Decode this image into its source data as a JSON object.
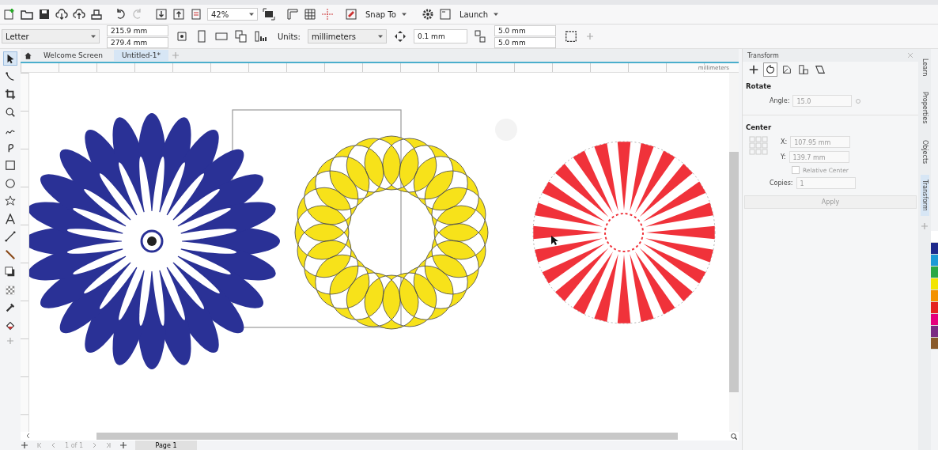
{
  "toolbar": {
    "zoom": "42%",
    "snap": "Snap To",
    "launch": "Launch"
  },
  "property_bar": {
    "paper": "Letter",
    "width": "215.9 mm",
    "height": "279.4 mm",
    "units_label": "Units:",
    "units": "millimeters",
    "nudge": "0.1 mm",
    "dup_h": "5.0 mm",
    "dup_v": "5.0 mm"
  },
  "tabs": [
    {
      "label": "Welcome Screen",
      "selected": false
    },
    {
      "label": "Untitled-1*",
      "selected": true
    }
  ],
  "ruler_unit": "millimeters",
  "tools": [
    {
      "kind": "pick",
      "selected": true
    },
    {
      "kind": "shape",
      "selected": false
    },
    {
      "kind": "crop",
      "selected": false
    },
    {
      "kind": "zoom",
      "selected": false
    },
    {
      "kind": "freehand",
      "selected": false
    },
    {
      "kind": "artistic",
      "selected": false
    },
    {
      "kind": "rect",
      "selected": false
    },
    {
      "kind": "ellipse",
      "selected": false
    },
    {
      "kind": "star",
      "selected": false
    },
    {
      "kind": "text",
      "selected": false
    },
    {
      "kind": "dimension",
      "selected": false
    },
    {
      "kind": "connector",
      "selected": false
    },
    {
      "kind": "shadow",
      "selected": false
    },
    {
      "kind": "transparency",
      "selected": false
    },
    {
      "kind": "eyedropper",
      "selected": false
    },
    {
      "kind": "fill",
      "selected": false
    }
  ],
  "docker": {
    "title": "Transform",
    "modes": [
      {
        "kind": "position",
        "selected": false
      },
      {
        "kind": "rotate",
        "selected": true
      },
      {
        "kind": "scale",
        "selected": false
      },
      {
        "kind": "size",
        "selected": false
      },
      {
        "kind": "skew",
        "selected": false
      }
    ],
    "rotate_heading": "Rotate",
    "angle_label": "Angle:",
    "angle": "15.0",
    "center_heading": "Center",
    "x_label": "X:",
    "x": "107.95 mm",
    "y_label": "Y:",
    "y": "139.7 mm",
    "relative_center": {
      "label": "Relative Center",
      "checked": false
    },
    "copies_label": "Copies:",
    "copies": "1",
    "apply": "Apply"
  },
  "side_tabs": [
    {
      "label": "Learn",
      "selected": false
    },
    {
      "label": "Properties",
      "selected": false
    },
    {
      "label": "Objects",
      "selected": false
    },
    {
      "label": "Transform",
      "selected": true
    }
  ],
  "palette": [
    {
      "color": "#ffffff"
    },
    {
      "color": "#1e2a8c"
    },
    {
      "color": "#1c9ad6"
    },
    {
      "color": "#2aa845"
    },
    {
      "color": "#f2e500"
    },
    {
      "color": "#f39200"
    },
    {
      "color": "#e52421"
    },
    {
      "color": "#e5007d"
    },
    {
      "color": "#7b2b83"
    },
    {
      "color": "#8a5a2b"
    }
  ],
  "page_nav": {
    "count": "1 of 1",
    "page_tab": "Page 1"
  }
}
